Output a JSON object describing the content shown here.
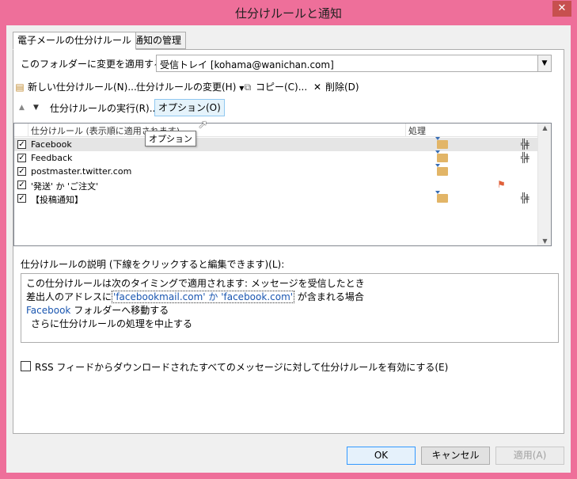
{
  "window": {
    "title": "仕分けルールと通知",
    "close_glyph": "✕"
  },
  "tabs": [
    {
      "label": "電子メールの仕分けルール",
      "active": true
    },
    {
      "label": "通知の管理",
      "active": false
    }
  ],
  "folder": {
    "label": "このフォルダーに変更を適用する(F):",
    "value": "受信トレイ [kohama@wanichan.com]"
  },
  "toolbar": {
    "new_rule": "新しい仕分けルール(N)...",
    "change_rule": "仕分けルールの変更(H)",
    "copy": "コピー(C)...",
    "delete": "削除(D)",
    "run_rules": "仕分けルールの実行(R)...",
    "options": "オプション(O)"
  },
  "rules_list": {
    "col_rule": "仕分けルール (表示順に適用されます)",
    "col_action": "処理",
    "rows": [
      {
        "name": "Facebook",
        "checked": true,
        "selected": true,
        "move": true,
        "flag": false,
        "stop": true
      },
      {
        "name": "Feedback",
        "checked": true,
        "selected": false,
        "move": true,
        "flag": false,
        "stop": true
      },
      {
        "name": "postmaster.twitter.com",
        "checked": true,
        "selected": false,
        "move": true,
        "flag": false,
        "stop": false
      },
      {
        "name": "'発送' か 'ご注文'",
        "checked": true,
        "selected": false,
        "move": false,
        "flag": true,
        "stop": false
      },
      {
        "name": "【投稿通知】",
        "checked": true,
        "selected": false,
        "move": true,
        "flag": false,
        "stop": true
      }
    ]
  },
  "tooltip": "オプション",
  "description": {
    "label": "仕分けルールの説明 (下線をクリックすると編集できます)(L):",
    "line1": "この仕分けルールは次のタイミングで適用されます: メッセージを受信したとき",
    "line2_prefix": "差出人のアドレスに",
    "line2_link": "'facebookmail.com' か 'facebook.com'",
    "line2_suffix": "が含まれる場合",
    "line3_link": "Facebook",
    "line3_suffix": " フォルダーへ移動する",
    "line4": "さらに仕分けルールの処理を中止する"
  },
  "rss": {
    "label": "RSS フィードからダウンロードされたすべてのメッセージに対して仕分けルールを有効にする(E)",
    "checked": false
  },
  "buttons": {
    "ok": "OK",
    "cancel": "キャンセル",
    "apply": "適用(A)"
  },
  "colors": {
    "frame": "#ee6f9a",
    "close": "#c7504f",
    "link": "#1a56b0"
  }
}
